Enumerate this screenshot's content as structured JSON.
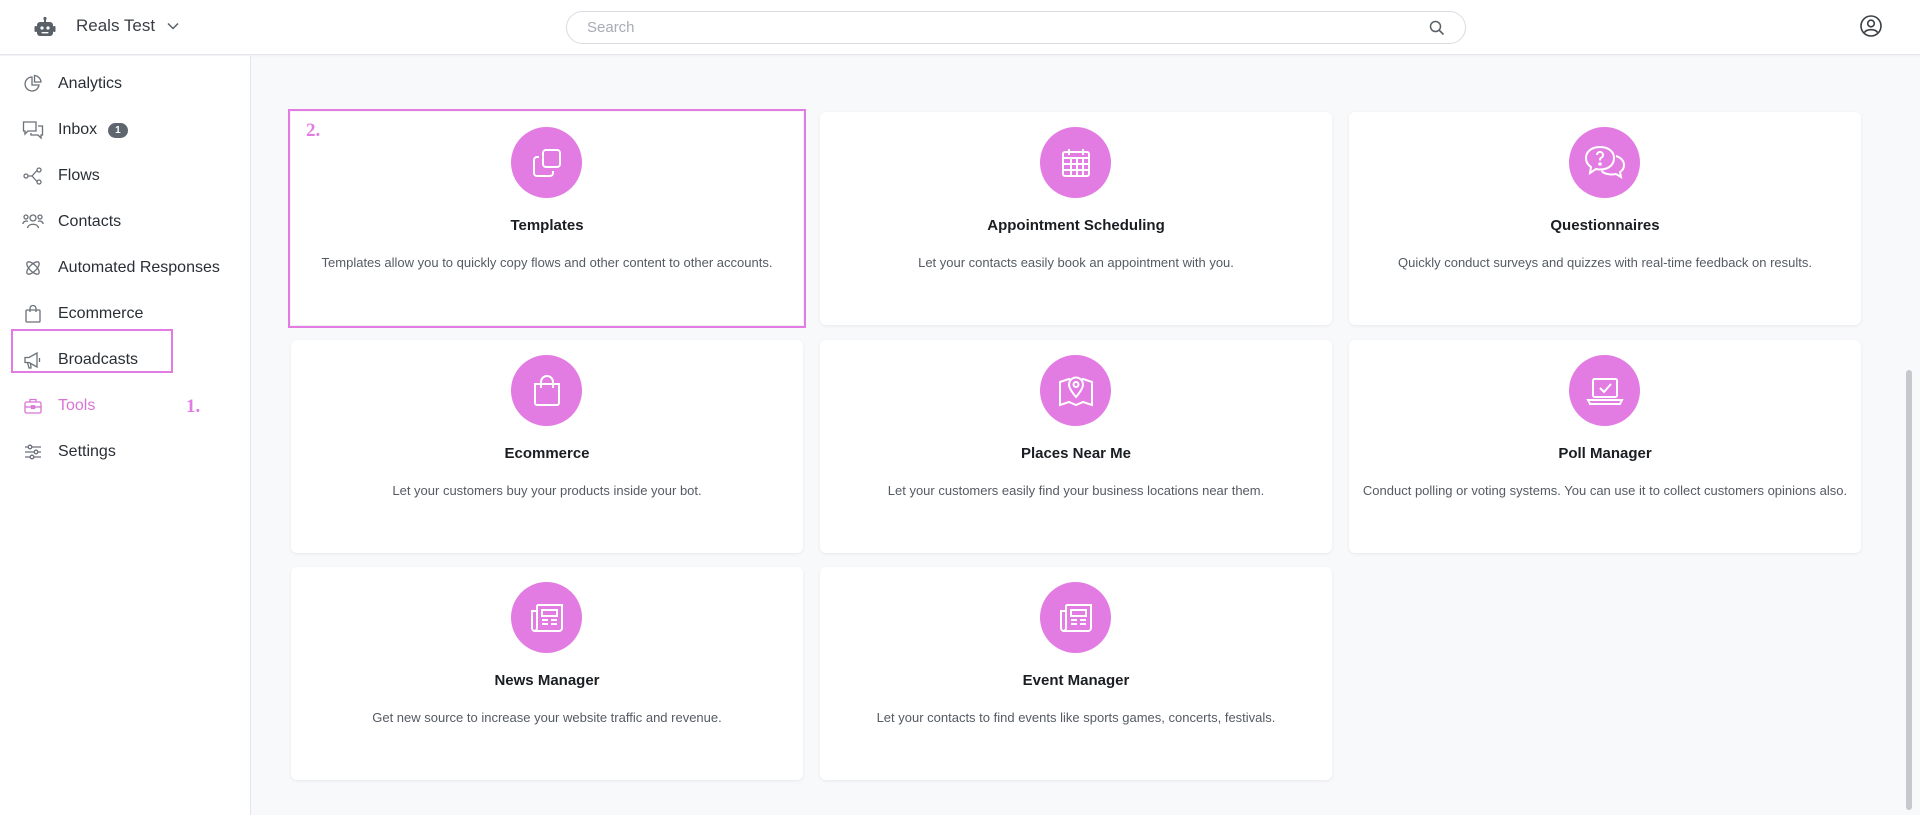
{
  "header": {
    "workspace_name": "Reals Test",
    "search_placeholder": "Search"
  },
  "sidebar": {
    "items": [
      {
        "label": "Analytics",
        "icon": "chart-pie-icon"
      },
      {
        "label": "Inbox",
        "icon": "chat-bubbles-icon",
        "badge": "1"
      },
      {
        "label": "Flows",
        "icon": "flow-nodes-icon"
      },
      {
        "label": "Contacts",
        "icon": "people-icon"
      },
      {
        "label": "Automated Responses",
        "icon": "atom-icon"
      },
      {
        "label": "Ecommerce",
        "icon": "shopping-bag-icon"
      },
      {
        "label": "Broadcasts",
        "icon": "megaphone-icon"
      },
      {
        "label": "Tools",
        "icon": "toolbox-icon",
        "active": true
      },
      {
        "label": "Settings",
        "icon": "sliders-icon"
      }
    ]
  },
  "annotations": {
    "step1": "1.",
    "step2": "2."
  },
  "tools": [
    {
      "title": "Templates",
      "description": "Templates allow you to quickly copy flows and other content to other accounts.",
      "icon": "copy-icon"
    },
    {
      "title": "Appointment Scheduling",
      "description": "Let your contacts easily book an appointment with you.",
      "icon": "calendar-icon"
    },
    {
      "title": "Questionnaires",
      "description": "Quickly conduct surveys and quizzes with real-time feedback on results.",
      "icon": "question-chat-icon"
    },
    {
      "title": "Ecommerce",
      "description": "Let your customers buy your products inside your bot.",
      "icon": "shopping-bag-icon"
    },
    {
      "title": "Places Near Me",
      "description": "Let your customers easily find your business locations near them.",
      "icon": "map-pin-icon"
    },
    {
      "title": "Poll Manager",
      "description": "Conduct polling or voting systems. You can use it to collect customers opinions also.",
      "icon": "laptop-check-icon"
    },
    {
      "title": "News Manager",
      "description": "Get new source to increase your website traffic and revenue.",
      "icon": "newspaper-icon"
    },
    {
      "title": "Event Manager",
      "description": "Let your contacts to find events like sports games, concerts, festivals.",
      "icon": "newspaper-icon"
    }
  ],
  "colors": {
    "accent": "#e27be2",
    "badge": "#5f6670"
  }
}
